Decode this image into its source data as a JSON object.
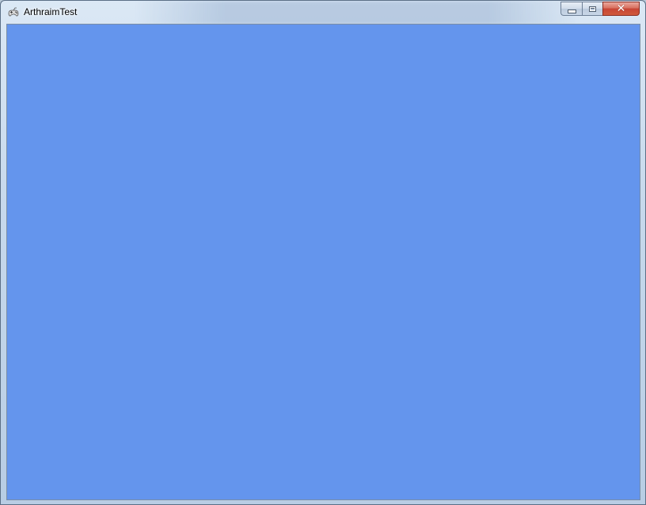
{
  "window": {
    "title": "ArthraimTest",
    "controls": {
      "minimize_icon": "minimize-icon",
      "maximize_icon": "maximize-icon",
      "close_icon": "close-icon",
      "close_glyph": "✕"
    }
  },
  "client": {
    "background_color": "#6495ED"
  },
  "colors": {
    "close_button": "#C74535",
    "frame": "#C7D9EC"
  }
}
